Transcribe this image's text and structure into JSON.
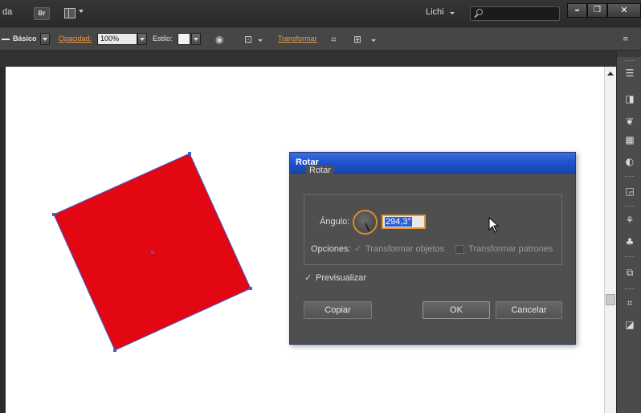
{
  "titlebar": {
    "left_fragment": "da",
    "bridge_button": "Br",
    "workspace_name": "Lichi",
    "search_placeholder": "",
    "minimize": "–",
    "restore": "❐",
    "close": "✕"
  },
  "controlbar": {
    "stroke_profile": "Básico",
    "opacity_label": "Opacidad:",
    "opacity_value": "100%",
    "style_label": "Estilo:",
    "transform_link": "Transformar"
  },
  "dialog": {
    "title": "Rotar",
    "group_label": "Rotar",
    "angle_label": "Ángulo:",
    "angle_value": "294,3°",
    "options_label": "Opciones:",
    "transform_objects": "Transformar objetos",
    "transform_patterns": "Transformar patrones",
    "preview": "Previsualizar",
    "copy_button": "Copiar",
    "ok_button": "OK",
    "cancel_button": "Cancelar"
  },
  "colors": {
    "shape_fill": "#e30613",
    "selection": "#3a62d8",
    "dialog_title": "#2557d6",
    "accent_orange": "#e29535"
  }
}
